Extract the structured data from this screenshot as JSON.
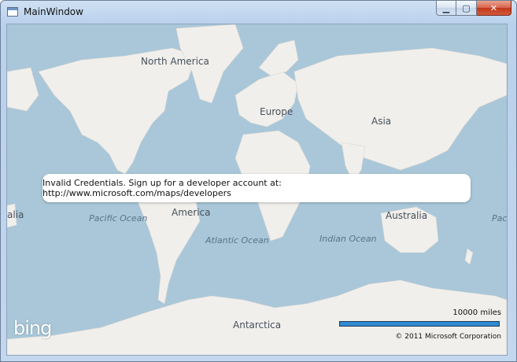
{
  "window": {
    "title": "MainWindow",
    "minimize_glyph": "▁",
    "maximize_glyph": "▢",
    "close_glyph": "✕"
  },
  "map": {
    "continents": {
      "north_america": "North America",
      "europe": "Europe",
      "asia": "Asia",
      "africa_partial_left": "alia",
      "south_america_partial": "America",
      "australia": "Australia",
      "antarctica": "Antarctica",
      "pacific_partial_right": "Pac"
    },
    "oceans": {
      "pacific": "Pacific Ocean",
      "atlantic": "Atlantic Ocean",
      "indian": "Indian Ocean"
    },
    "error_message": "Invalid Credentials. Sign up for a developer account at: http://www.microsoft.com/maps/developers",
    "logo_text": "bing",
    "scale_label": "10000 miles",
    "copyright": "© 2011 Microsoft Corporation",
    "colors": {
      "water": "#a9c7d9",
      "land": "#f1efec",
      "scale_bar": "#2f8ad2"
    }
  }
}
